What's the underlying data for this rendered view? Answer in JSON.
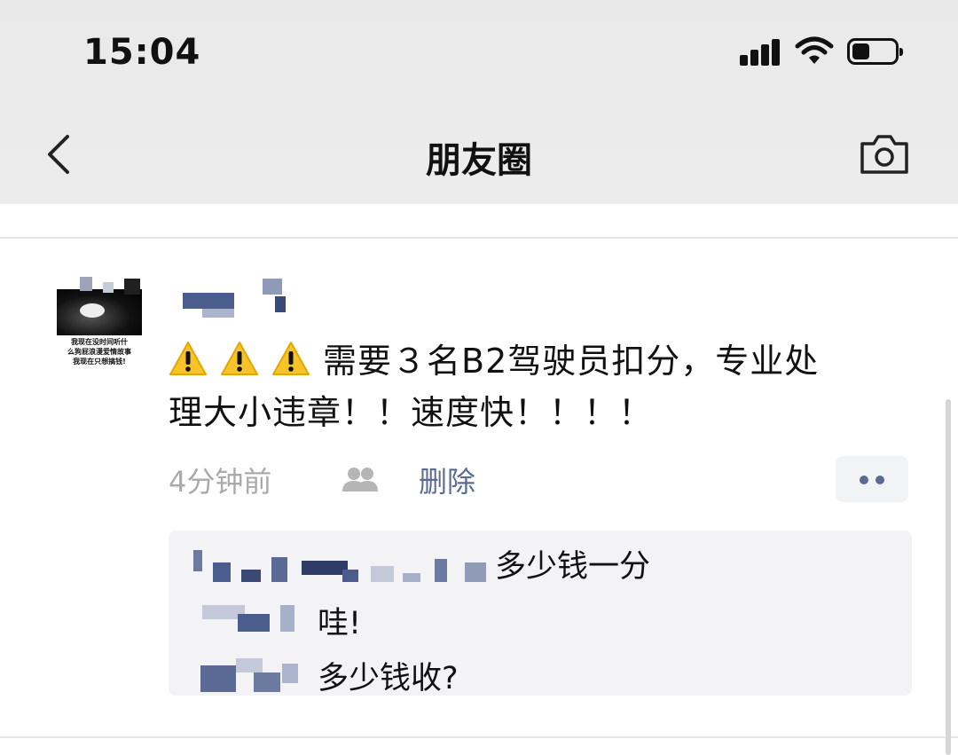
{
  "status_bar": {
    "time": "15:04",
    "icons": [
      "signal-icon",
      "wifi-icon",
      "battery-icon"
    ]
  },
  "nav": {
    "title": "朋友圈",
    "back_icon": "chevron-left-icon",
    "camera_icon": "camera-icon"
  },
  "avatar": {
    "caption_lines": [
      "我现在没时间听什",
      "么狗屁浪漫爱情故事",
      "我现在只想搞钱!"
    ]
  },
  "post": {
    "warning_icon": "warning-icon",
    "text_line1": "需要３名B2驾驶员扣分，专业处",
    "text_line2": "理大小违章！！速度快！！！！",
    "time_ago": "4分钟前",
    "delete_label": "删除",
    "friends_icon": "friends-visibility-icon",
    "more_icon": "more-dots-icon"
  },
  "comments": [
    {
      "text": "多少钱一分"
    },
    {
      "text": "哇!"
    },
    {
      "text": "多少钱收?"
    }
  ],
  "colors": {
    "link": "#5b6a92",
    "meta_gray": "#aaaaaa",
    "comment_bg": "#f3f3f5",
    "header_bg": "#ebebeb"
  }
}
